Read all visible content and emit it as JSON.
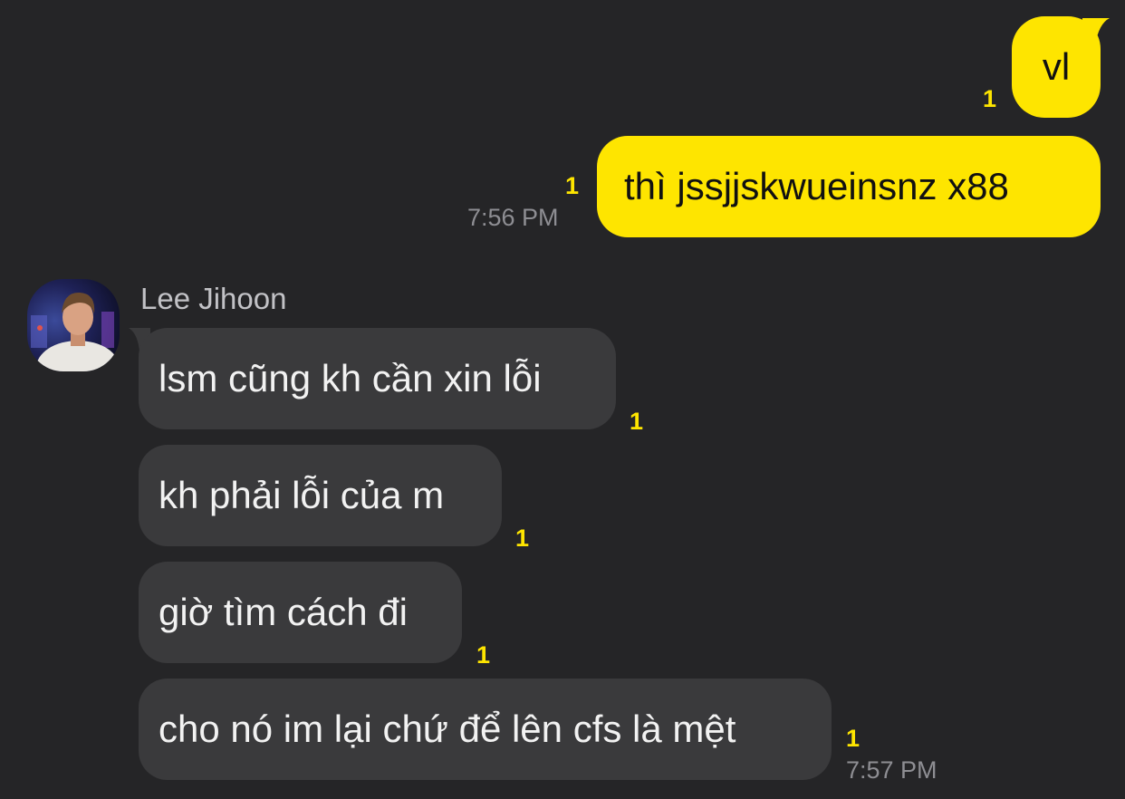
{
  "colors": {
    "background": "#252527",
    "outgoing_bubble": "#FEE500",
    "incoming_bubble": "#3a3a3c",
    "unread_count": "#FEE500",
    "timestamp": "#8e8e93"
  },
  "outgoing": [
    {
      "text": "vl",
      "unread": "1",
      "time": ""
    },
    {
      "text": "thì jssjjskwueinsnz x88",
      "unread": "1",
      "time": "7:56 PM"
    }
  ],
  "incoming": {
    "sender": "Lee Jihoon",
    "avatar_icon": "profile-photo",
    "messages": [
      {
        "text": "lsm cũng kh cần xin lỗi",
        "unread": "1",
        "time": ""
      },
      {
        "text": "kh phải lỗi của m",
        "unread": "1",
        "time": ""
      },
      {
        "text": "giờ tìm cách đi",
        "unread": "1",
        "time": ""
      },
      {
        "text": "cho nó im lại chứ để lên cfs là mệt",
        "unread": "1",
        "time": "7:57 PM"
      }
    ]
  }
}
